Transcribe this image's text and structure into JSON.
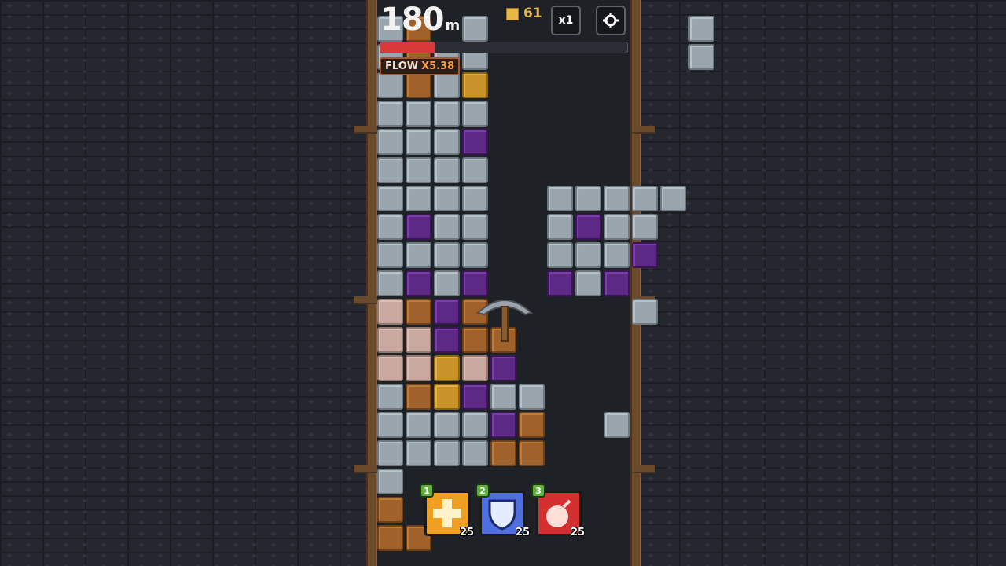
{
  "hud": {
    "depth_value": "180",
    "depth_unit": "m",
    "coins": "61",
    "speed_label": "x1",
    "settings_icon": "gear-icon",
    "progress_fraction": 0.22,
    "flow_label": "FLOW",
    "flow_value": "X5.38"
  },
  "items": [
    {
      "key": "1",
      "count": "25",
      "icon": "heal-plus-icon",
      "color": "#f0a020"
    },
    {
      "key": "2",
      "count": "25",
      "icon": "shield-icon",
      "color": "#4f6fe0"
    },
    {
      "key": "3",
      "count": "25",
      "icon": "bomb-icon",
      "color": "#d43030"
    }
  ],
  "colors": {
    "progress": "#d83a3a",
    "flow_accent": "#ff9a4a",
    "coin": "#e6b84a"
  }
}
